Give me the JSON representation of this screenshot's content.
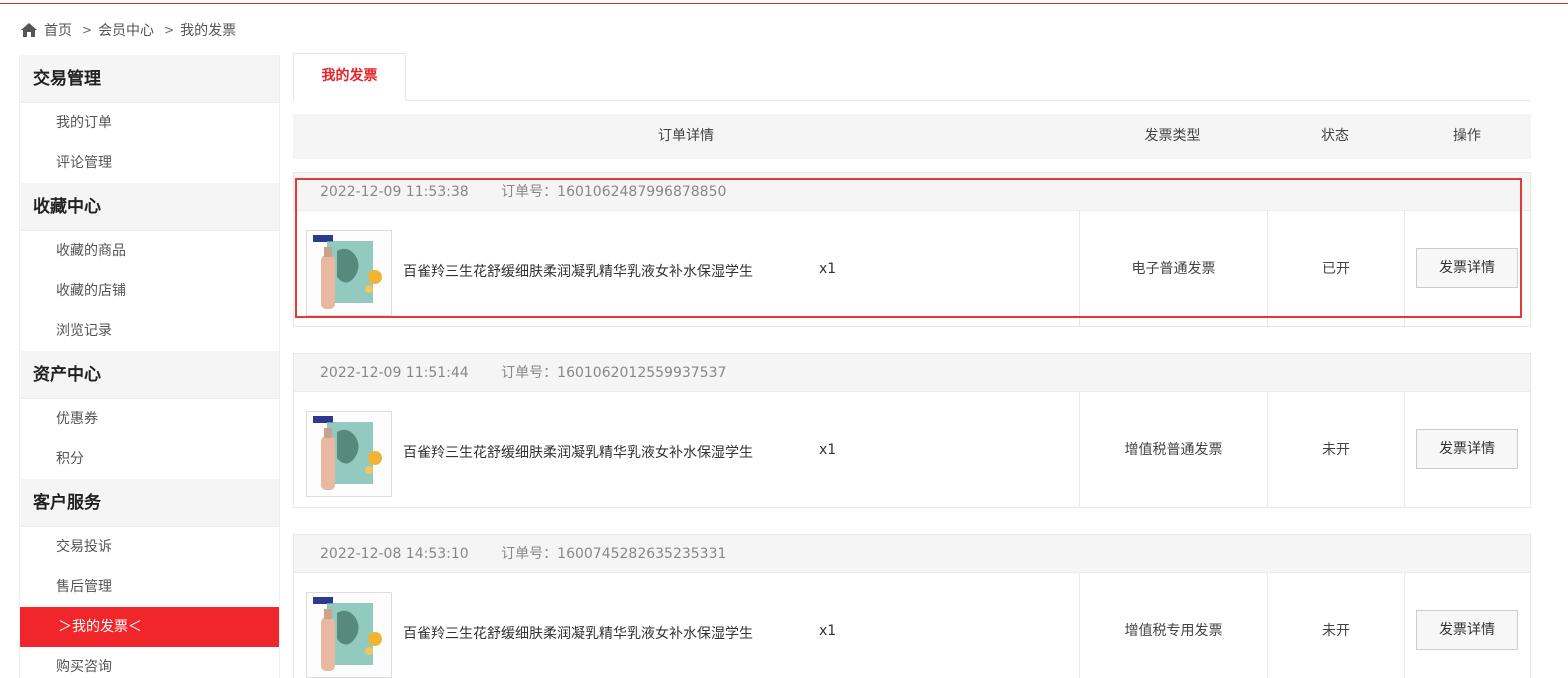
{
  "breadcrumb": {
    "items": [
      "首页",
      "会员中心",
      "我的发票"
    ],
    "separator": ">"
  },
  "sidebar": {
    "groups": [
      {
        "title": "交易管理",
        "items": [
          "我的订单",
          "评论管理"
        ]
      },
      {
        "title": "收藏中心",
        "items": [
          "收藏的商品",
          "收藏的店铺",
          "浏览记录"
        ]
      },
      {
        "title": "资产中心",
        "items": [
          "优惠券",
          "积分"
        ]
      },
      {
        "title": "客户服务",
        "items": [
          "交易投诉",
          "售后管理",
          "＞我的发票＜",
          "购买咨询"
        ]
      }
    ],
    "active_item": "＞我的发票＜"
  },
  "main": {
    "tab_label": "我的发票",
    "columns": [
      "订单详情",
      "发票类型",
      "状态",
      "操作"
    ],
    "orders": [
      {
        "time": "2022-12-09 11:53:38",
        "order_no": "订单号：1601062487996878850",
        "product": "百雀羚三生花舒缓细肤柔润凝乳精华乳液女补水保湿学生",
        "qty": "x1",
        "invoice_type": "电子普通发票",
        "status": "已开",
        "action": "发票详情"
      },
      {
        "time": "2022-12-09 11:51:44",
        "order_no": "订单号：1601062012559937537",
        "product": "百雀羚三生花舒缓细肤柔润凝乳精华乳液女补水保湿学生",
        "qty": "x1",
        "invoice_type": "增值税普通发票",
        "status": "未开",
        "action": "发票详情"
      },
      {
        "time": "2022-12-08 14:53:10",
        "order_no": "订单号：1600745282635235331",
        "product": "百雀羚三生花舒缓细肤柔润凝乳精华乳液女补水保湿学生",
        "qty": "x1",
        "invoice_type": "增值税专用发票",
        "status": "未开",
        "action": "发票详情"
      }
    ]
  },
  "colors": {
    "accent": "#f0262b",
    "highlight_box": "#e53935"
  }
}
